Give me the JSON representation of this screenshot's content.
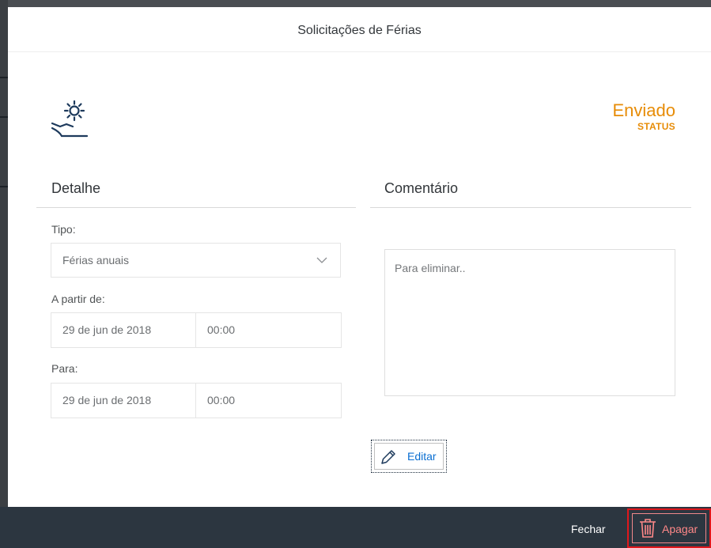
{
  "dialog": {
    "title": "Solicitações de Férias"
  },
  "header_icon": "vacation-lounger-sun-icon",
  "status": {
    "value": "Enviado",
    "label": "STATUS",
    "color": "#e78c07"
  },
  "detail": {
    "section_title": "Detalhe",
    "type_label": "Tipo:",
    "type_value": "Férias anuais",
    "from_label": "A partir de:",
    "from_date": "29 de jun de 2018",
    "from_time": "00:00",
    "to_label": "Para:",
    "to_date": "29 de jun de 2018",
    "to_time": "00:00"
  },
  "comment": {
    "section_title": "Comentário",
    "placeholder": "Para eliminar.."
  },
  "actions": {
    "edit_label": "Editar",
    "close_label": "Fechar",
    "delete_label": "Apagar"
  },
  "colors": {
    "footer_bg": "#2c3640",
    "accent_blue": "#0a6ed1",
    "delete_red": "#e0171c",
    "icon_navy": "#1d3a5c"
  }
}
